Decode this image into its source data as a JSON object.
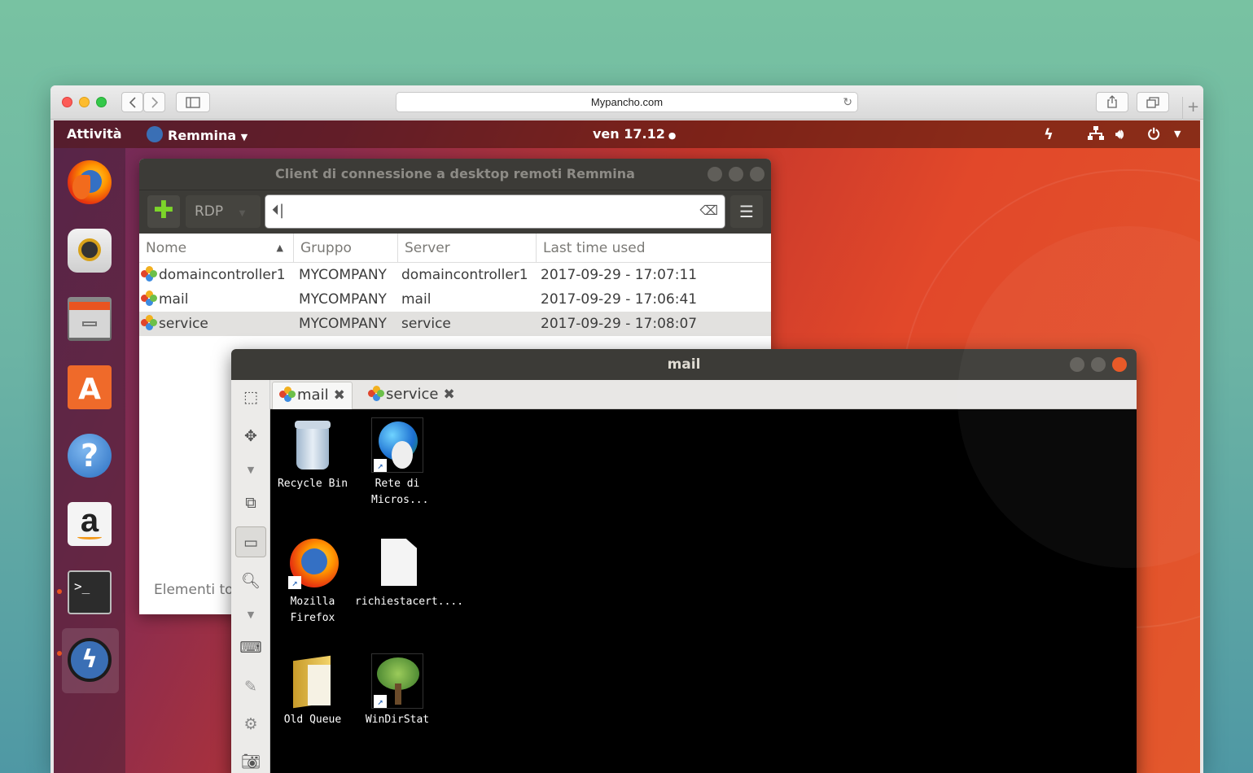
{
  "browser": {
    "url": "Mypancho.com",
    "new_tab": "+"
  },
  "topbar": {
    "activities": "Attività",
    "app_name": "Remmina",
    "clock": "ven 17.12"
  },
  "launcher": {
    "items": [
      "firefox-icon",
      "rhythmbox-icon",
      "files-icon",
      "software-center-icon",
      "help-icon",
      "amazon-icon",
      "terminal-icon",
      "remmina-icon"
    ]
  },
  "remmina": {
    "title": "Client di connessione a desktop remoti Remmina",
    "protocol": "RDP",
    "columns": [
      "Nome",
      "Gruppo",
      "Server",
      "Last time used"
    ],
    "rows": [
      {
        "name": "domaincontroller1",
        "group": "MYCOMPANY",
        "server": "domaincontroller1",
        "last": "2017-09-29 - 17:07:11"
      },
      {
        "name": "mail",
        "group": "MYCOMPANY",
        "server": "mail",
        "last": "2017-09-29 - 17:06:41"
      },
      {
        "name": "service",
        "group": "MYCOMPANY",
        "server": "service",
        "last": "2017-09-29 - 17:08:07"
      }
    ],
    "status": "Elementi to"
  },
  "mail_window": {
    "title": "mail",
    "tabs": [
      "mail",
      "service"
    ],
    "desktop_icons": [
      "Recycle Bin",
      "Rete di Micros...",
      "Mozilla Firefox",
      "richiestacert....",
      "Old Queue",
      "WinDirStat"
    ]
  },
  "colors": {
    "ubuntu_orange": "#e95420",
    "remmina_dark": "#3c3b37"
  }
}
